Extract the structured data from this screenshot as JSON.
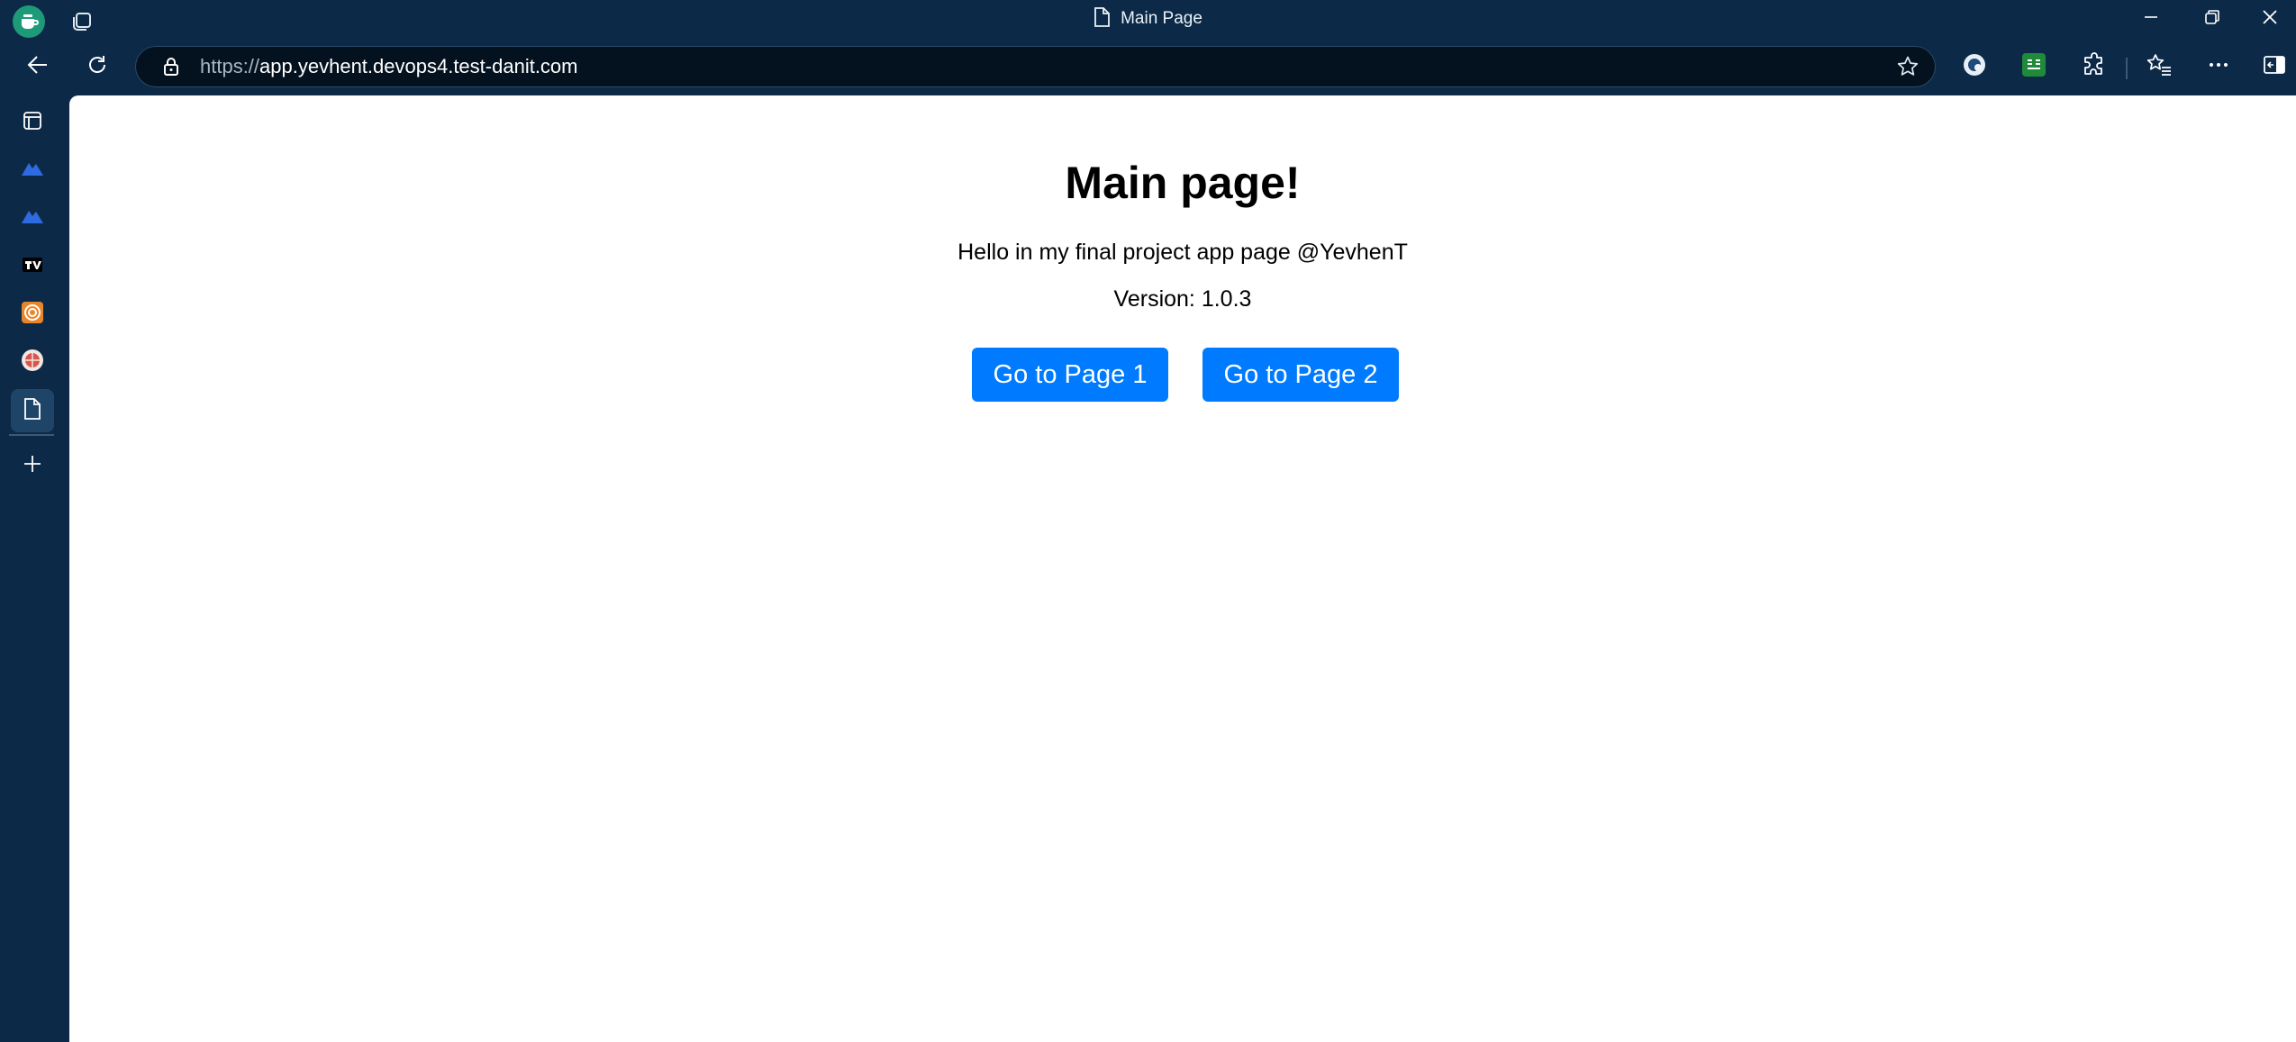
{
  "window": {
    "tab_title": "Main Page",
    "icons": [
      "profile-icon",
      "workspaces-icon",
      "page-icon",
      "minimize-icon",
      "restore-icon",
      "close-icon"
    ]
  },
  "toolbar": {
    "url_protocol": "https://",
    "url_host": "app.yevhent.devops4.test-danit.com",
    "icons": [
      "back-icon",
      "refresh-icon",
      "lock-icon",
      "favorite-star-icon",
      "extension-a-icon",
      "extension-b-icon",
      "extensions-icon",
      "favorites-icon",
      "more-icon",
      "sidebar-toggle-icon"
    ]
  },
  "sidebar": {
    "items": [
      "tab-actions-icon",
      "cloud-app-icon-1",
      "cloud-app-icon-2",
      "tradingview-icon",
      "target-app-icon",
      "globe-app-icon",
      "page-tab-icon",
      "add-icon"
    ],
    "accent_colors": {
      "cloud": "#2f6be0",
      "target": "#e8862b",
      "globe": "#d9554a",
      "active": "#1e4467"
    }
  },
  "page": {
    "heading": "Main page!",
    "greeting": "Hello in my final project app page @YevhenT",
    "version": "Version: 1.0.3",
    "buttons": [
      {
        "label": "Go to Page 1"
      },
      {
        "label": "Go to Page 2"
      }
    ],
    "button_color": "#007bff"
  }
}
